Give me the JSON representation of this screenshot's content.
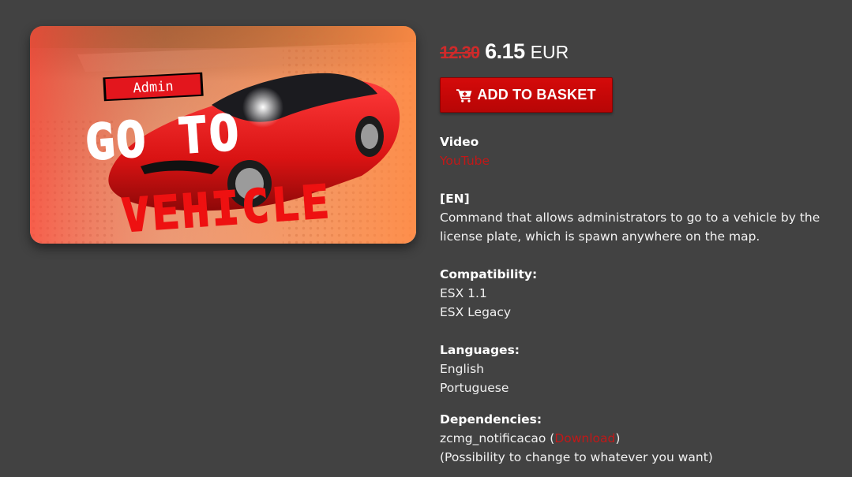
{
  "product": {
    "image": {
      "badge_text": "Admin",
      "title_line1": "GO TO",
      "title_line2": "VEHICLE"
    },
    "price": {
      "old": "12.30",
      "new": "6.15",
      "currency": "EUR"
    },
    "basket_button": {
      "label": "ADD TO BASKET",
      "icon": "shopping-cart-icon"
    }
  },
  "info": {
    "video": {
      "heading": "Video",
      "link": "YouTube"
    },
    "description": {
      "lang_tag": "[EN]",
      "text": "Command that allows administrators to go to a vehicle by the license plate, which is spawn anywhere on the map."
    },
    "compatibility": {
      "heading": "Compatibility:",
      "items": [
        "ESX 1.1",
        "ESX Legacy"
      ]
    },
    "languages": {
      "heading": "Languages:",
      "items": [
        "English",
        "Portuguese"
      ]
    },
    "dependencies": {
      "heading": "Dependencies:",
      "name": "zcmg_notificacao",
      "open_paren": " (",
      "download_link": "Download",
      "close_paren": ")",
      "note": "(Possibility to change to whatever you want)"
    }
  },
  "colors": {
    "background": "#424242",
    "accent_red": "#c11818",
    "button_red": "#c60808",
    "text": "#ffffff"
  }
}
